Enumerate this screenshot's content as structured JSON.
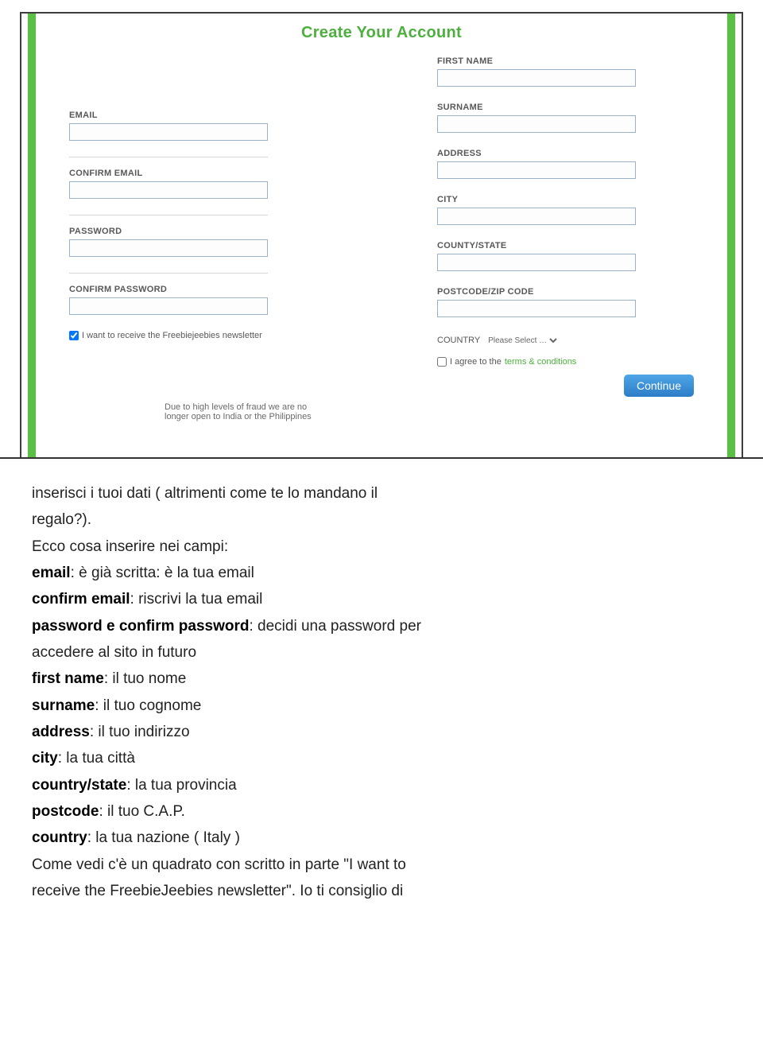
{
  "form": {
    "title": "Create Your Account",
    "left": {
      "email_label": "EMAIL",
      "confirm_email_label": "CONFIRM EMAIL",
      "password_label": "PASSWORD",
      "confirm_password_label": "CONFIRM PASSWORD",
      "newsletter_text": "I want to receive the Freebiejeebies newsletter"
    },
    "right": {
      "firstname_label": "FIRST NAME",
      "surname_label": "SURNAME",
      "address_label": "ADDRESS",
      "city_label": "CITY",
      "county_label": "COUNTY/STATE",
      "postcode_label": "POSTCODE/ZIP CODE",
      "country_label": "COUNTRY",
      "country_placeholder": "Please Select …",
      "agree_prefix": "I agree to the",
      "terms_link": "terms & conditions",
      "continue_label": "Continue"
    },
    "cutoff_text": "Due to high levels of fraud we are no longer open to India or the Philippines"
  },
  "instructions": {
    "line1a": "inserisci i tuoi dati ( altrimenti come te lo mandano il",
    "line1b": "regalo?).",
    "line2": "Ecco cosa inserire nei campi:",
    "email_b": "email",
    "email_t": ": è già scritta: è la tua email",
    "cemail_b": "confirm email",
    "cemail_t": ": riscrivi la tua email",
    "pw_b": "password e confirm password",
    "pw_t": ": decidi una password per",
    "pw_t2": "accedere al sito in futuro",
    "fn_b": "first name",
    "fn_t": ": il tuo nome",
    "sn_b": "surname",
    "sn_t": ": il tuo cognome",
    "ad_b": "address",
    "ad_t": ": il tuo indirizzo",
    "ci_b": "city",
    "ci_t": ": la tua città",
    "cs_b": "country/state",
    "cs_t": ": la tua provincia",
    "pc_b": "postcode",
    "pc_t": ": il tuo C.A.P.",
    "co_b": "country",
    "co_t": ": la tua nazione ( Italy )",
    "line_last1": "Come vedi c'è un quadrato con scritto in parte \"I want to",
    "line_last2": "receive the FreebieJeebies newsletter\". Io ti consiglio di"
  }
}
